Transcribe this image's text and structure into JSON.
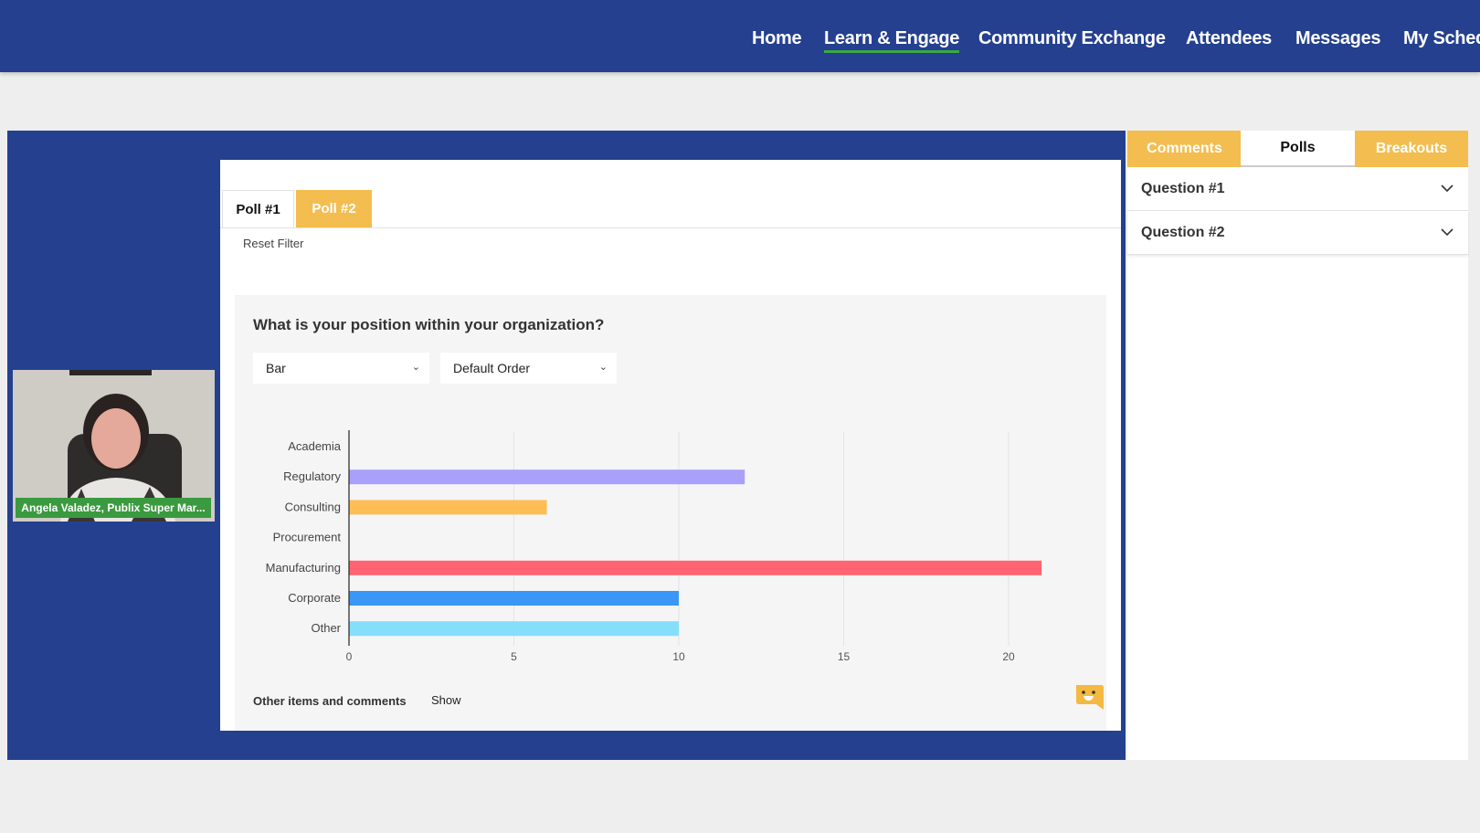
{
  "nav": {
    "items": [
      {
        "label": "Home"
      },
      {
        "label": "Learn & Engage",
        "active": true
      },
      {
        "label": "Community Exchange"
      },
      {
        "label": "Attendees"
      },
      {
        "label": "Messages"
      },
      {
        "label": "My Schedule"
      }
    ],
    "active_underline_color": "#3aa845"
  },
  "video": {
    "name_label": "Angela Valadez, Publix Super Mar..."
  },
  "poll": {
    "tabs": [
      {
        "label": "Poll #1",
        "active": true
      },
      {
        "label": "Poll #2"
      }
    ],
    "reset_filter": "Reset Filter",
    "question": "What is your position within your organization?",
    "chart_type_select": "Bar",
    "order_select": "Default Order",
    "other_items_label": "Other items and comments",
    "show_link": "Show",
    "chat_icon": "smiley-chat-icon"
  },
  "sidebar": {
    "tabs": [
      {
        "label": "Comments"
      },
      {
        "label": "Polls",
        "active": true
      },
      {
        "label": "Breakouts"
      }
    ],
    "questions": [
      {
        "label": "Question #1"
      },
      {
        "label": "Question #2"
      }
    ]
  },
  "colors": {
    "brand_blue": "#24408f",
    "accent_yellow": "#f3bd4f"
  },
  "chart_data": {
    "type": "bar",
    "orientation": "horizontal",
    "categories": [
      "Academia",
      "Regulatory",
      "Consulting",
      "Procurement",
      "Manufacturing",
      "Corporate",
      "Other"
    ],
    "values": [
      0,
      12,
      6,
      0,
      21,
      10,
      10
    ],
    "colors": [
      "#a8a0fb",
      "#a8a0fb",
      "#fdbe55",
      "#ffa8a8",
      "#ff6470",
      "#3b97f5",
      "#85dffa"
    ],
    "xticks": [
      0,
      5,
      10,
      15,
      20
    ],
    "xlim": [
      0,
      21.5
    ],
    "grid": true,
    "title": "",
    "xlabel": "",
    "ylabel": ""
  }
}
